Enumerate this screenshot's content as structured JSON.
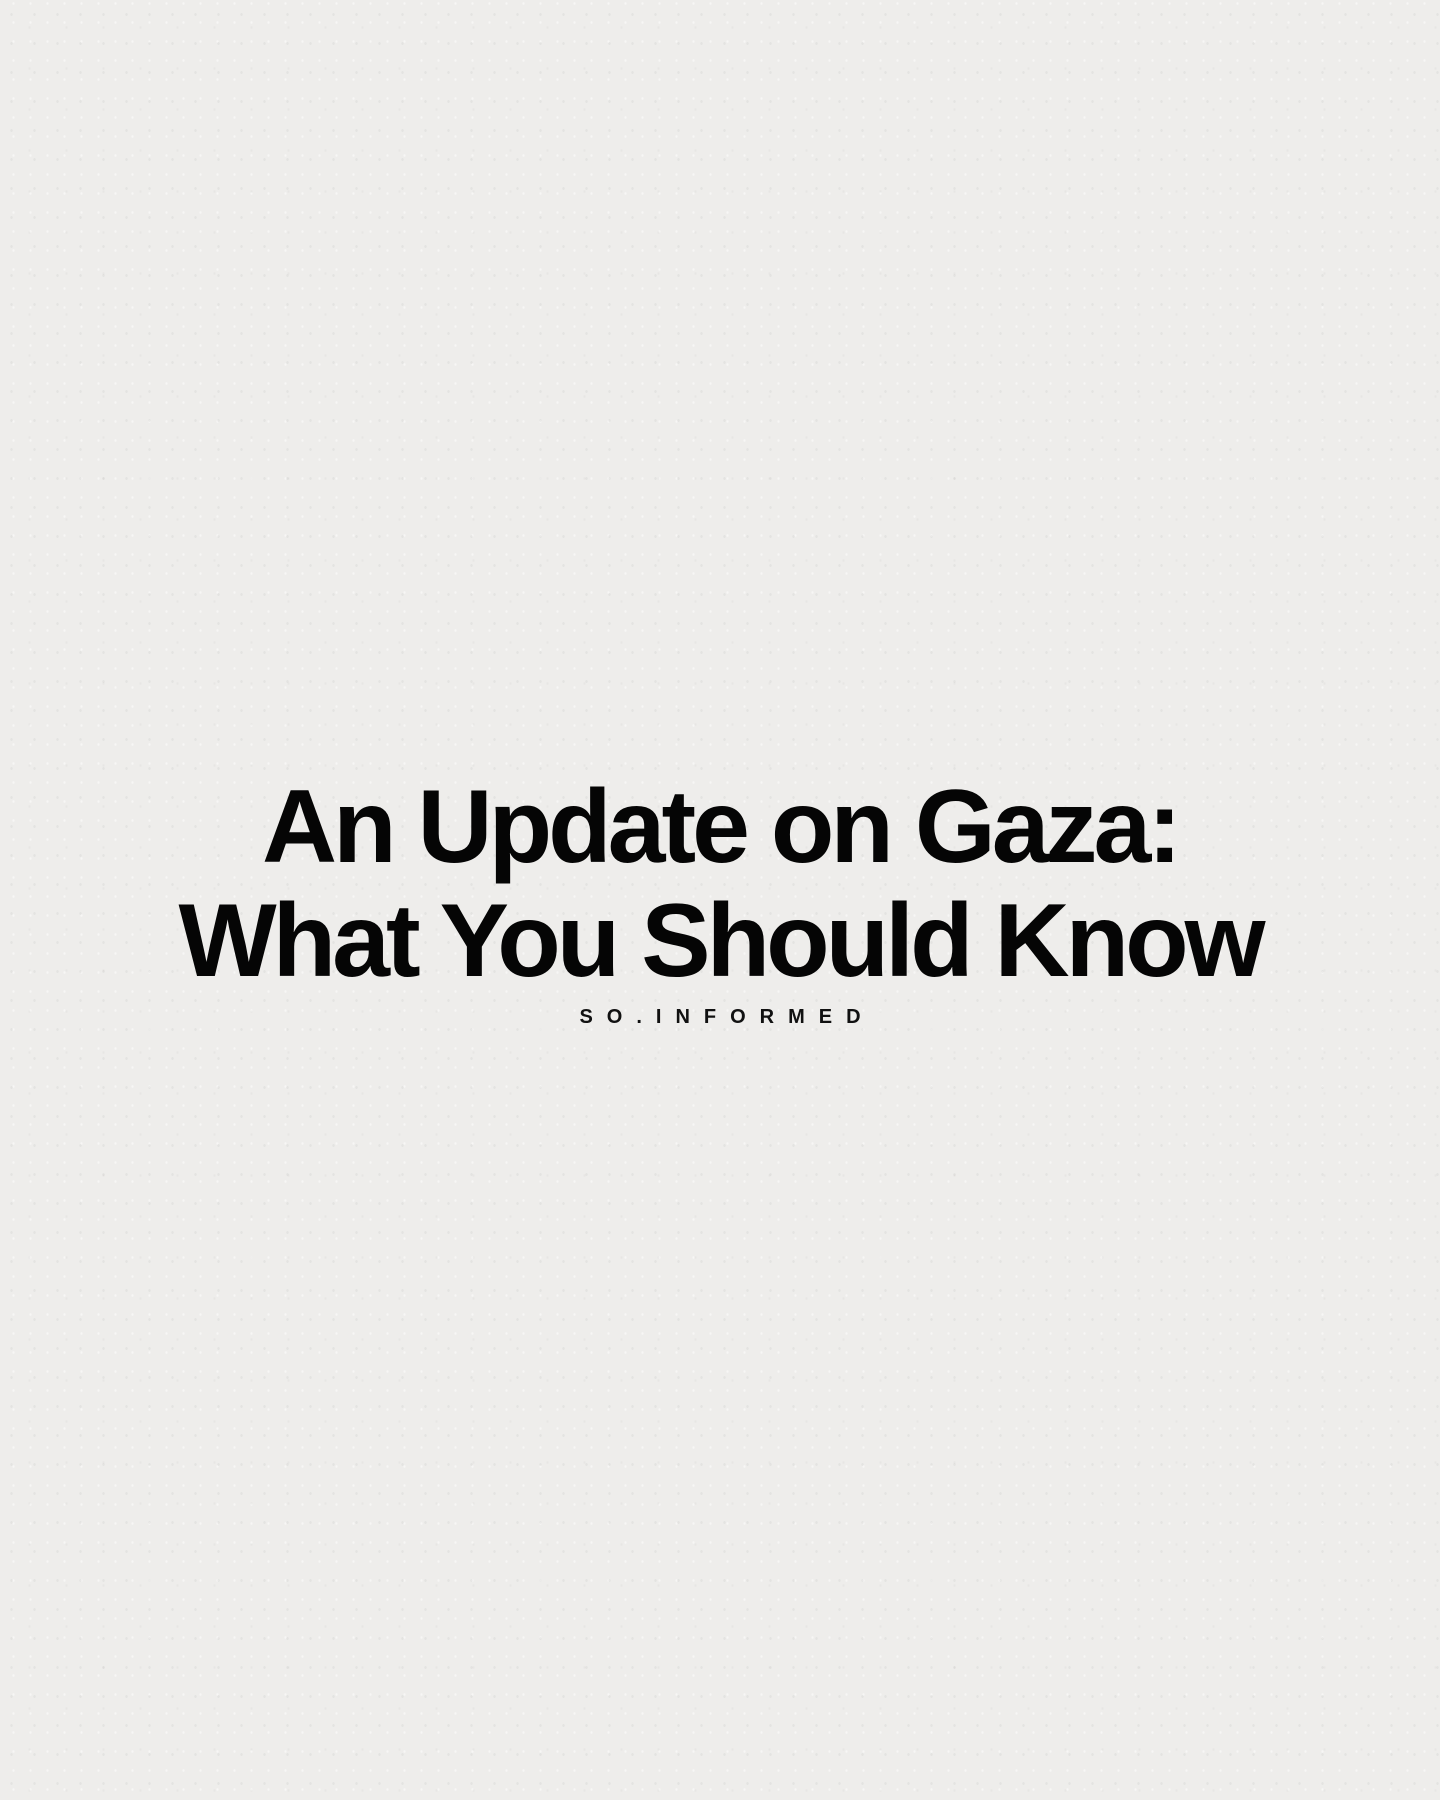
{
  "headline": {
    "line1": "An Update on Gaza:",
    "line2": "What You Should Know"
  },
  "brand": {
    "label": "SO.INFORMED"
  },
  "colors": {
    "background": "#eeedeb",
    "text": "#050505"
  }
}
